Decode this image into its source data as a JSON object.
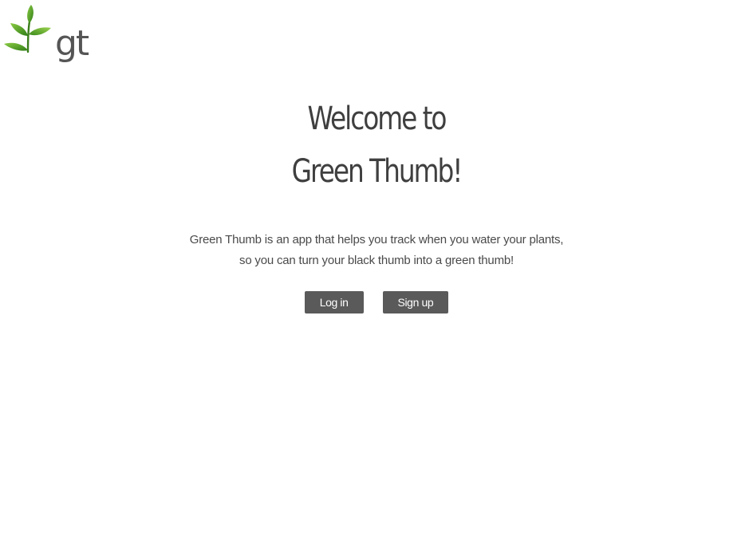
{
  "logo": {
    "text": "gt",
    "icon": "sprout-icon",
    "colors": {
      "leaf": "#3f8f1f",
      "leaf_light": "#7cc43a",
      "text": "#555555"
    }
  },
  "hero": {
    "title_line1": "Welcome to",
    "title_line2": "Green Thumb!",
    "description_line1": "Green Thumb is an app that helps you track when you water your plants,",
    "description_line2": "so you can turn your black thumb into a green thumb!"
  },
  "actions": {
    "login_label": "Log in",
    "signup_label": "Sign up"
  },
  "colors": {
    "button_bg": "#5a5a5a",
    "button_text": "#ffffff",
    "title_text": "#3f3f3f",
    "body_text": "#4a4a4a"
  }
}
